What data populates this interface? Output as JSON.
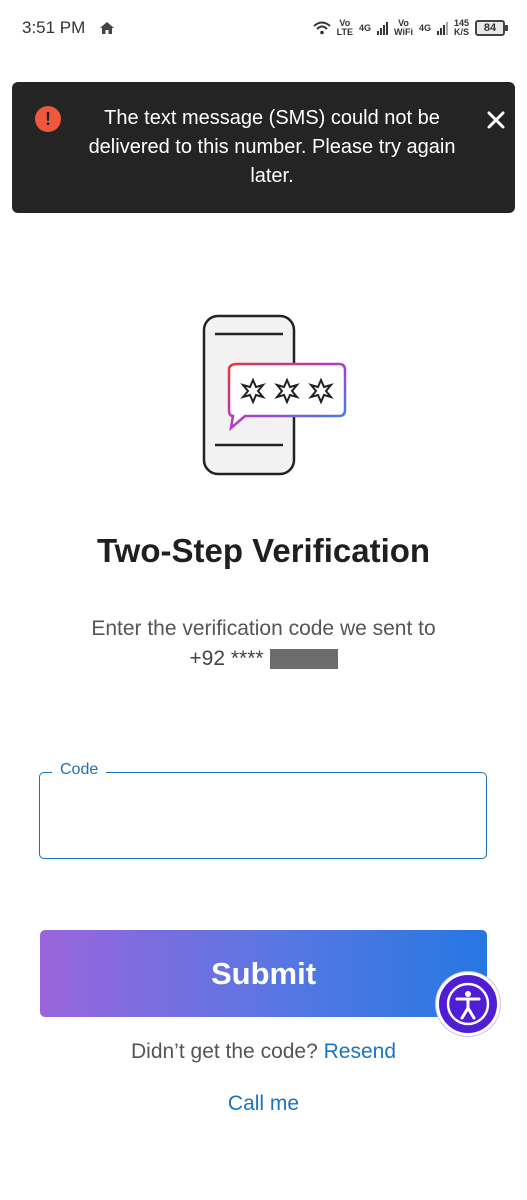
{
  "status_bar": {
    "time": "3:51 PM",
    "net1_top": "Vo",
    "net1_bottom": "LTE",
    "net1_type": "4G",
    "net2_top": "Vo",
    "net2_bottom": "WiFi",
    "net2_type": "4G",
    "speed_value": "145",
    "speed_unit": "K/S",
    "battery": "84",
    "icons": [
      "home-icon",
      "wifi-icon",
      "signal-icon",
      "battery-icon"
    ]
  },
  "toast": {
    "message": "The text message (SMS) could not be delivered to this number. Please try again later.",
    "icon": "error-icon",
    "close_icon": "close-icon",
    "error_color": "#f0573b"
  },
  "main": {
    "title": "Two-Step Verification",
    "subtitle": "Enter the verification code we sent to",
    "phone_prefix": "+92 ****"
  },
  "code_field": {
    "label": "Code",
    "value": ""
  },
  "submit_label": "Submit",
  "resend": {
    "question": "Didn’t get the code?",
    "link": "Resend"
  },
  "call_me": "Call me",
  "colors": {
    "accent_blue": "#1b74c0",
    "gradient_start": "#9a65dc",
    "gradient_end": "#2677e2",
    "accessibility": "#4f1dd4"
  }
}
